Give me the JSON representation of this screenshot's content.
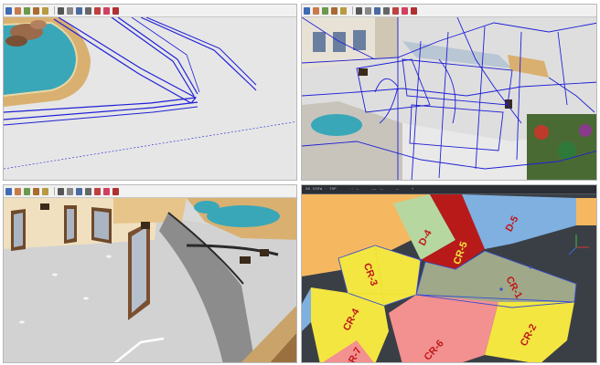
{
  "colors": {
    "selection_blue": "#1f1fd6",
    "pool_water": "#3aa7b8",
    "pool_deck": "#d9b070",
    "cad_background": "#3a3f46",
    "room_label_red": "#c01818"
  },
  "toolbar_icons": [
    "select-arrow-icon",
    "eraser-icon",
    "paint-bucket-icon",
    "pencil-icon",
    "rectangle-icon",
    "circle-icon",
    "push-pull-icon",
    "move-icon",
    "rotate-icon",
    "offset-icon",
    "tape-measure-icon",
    "orbit-icon",
    "pan-icon",
    "zoom-icon",
    "zoom-extents-icon",
    "section-icon",
    "component-icon",
    "warehouse-icon"
  ],
  "cad": {
    "header_items": [
      "3D VIEW · TOP",
      "·· —",
      "—— ·—",
      "—",
      "+"
    ],
    "rooms": {
      "d5": "D-5",
      "d4": "D-4",
      "cr5": "CR-5",
      "cr3": "CR-3",
      "cr1": "CR-1",
      "cr4": "CR-4",
      "cr2": "CR-2",
      "cr6": "CR-6",
      "cr7": "CR-7"
    }
  }
}
